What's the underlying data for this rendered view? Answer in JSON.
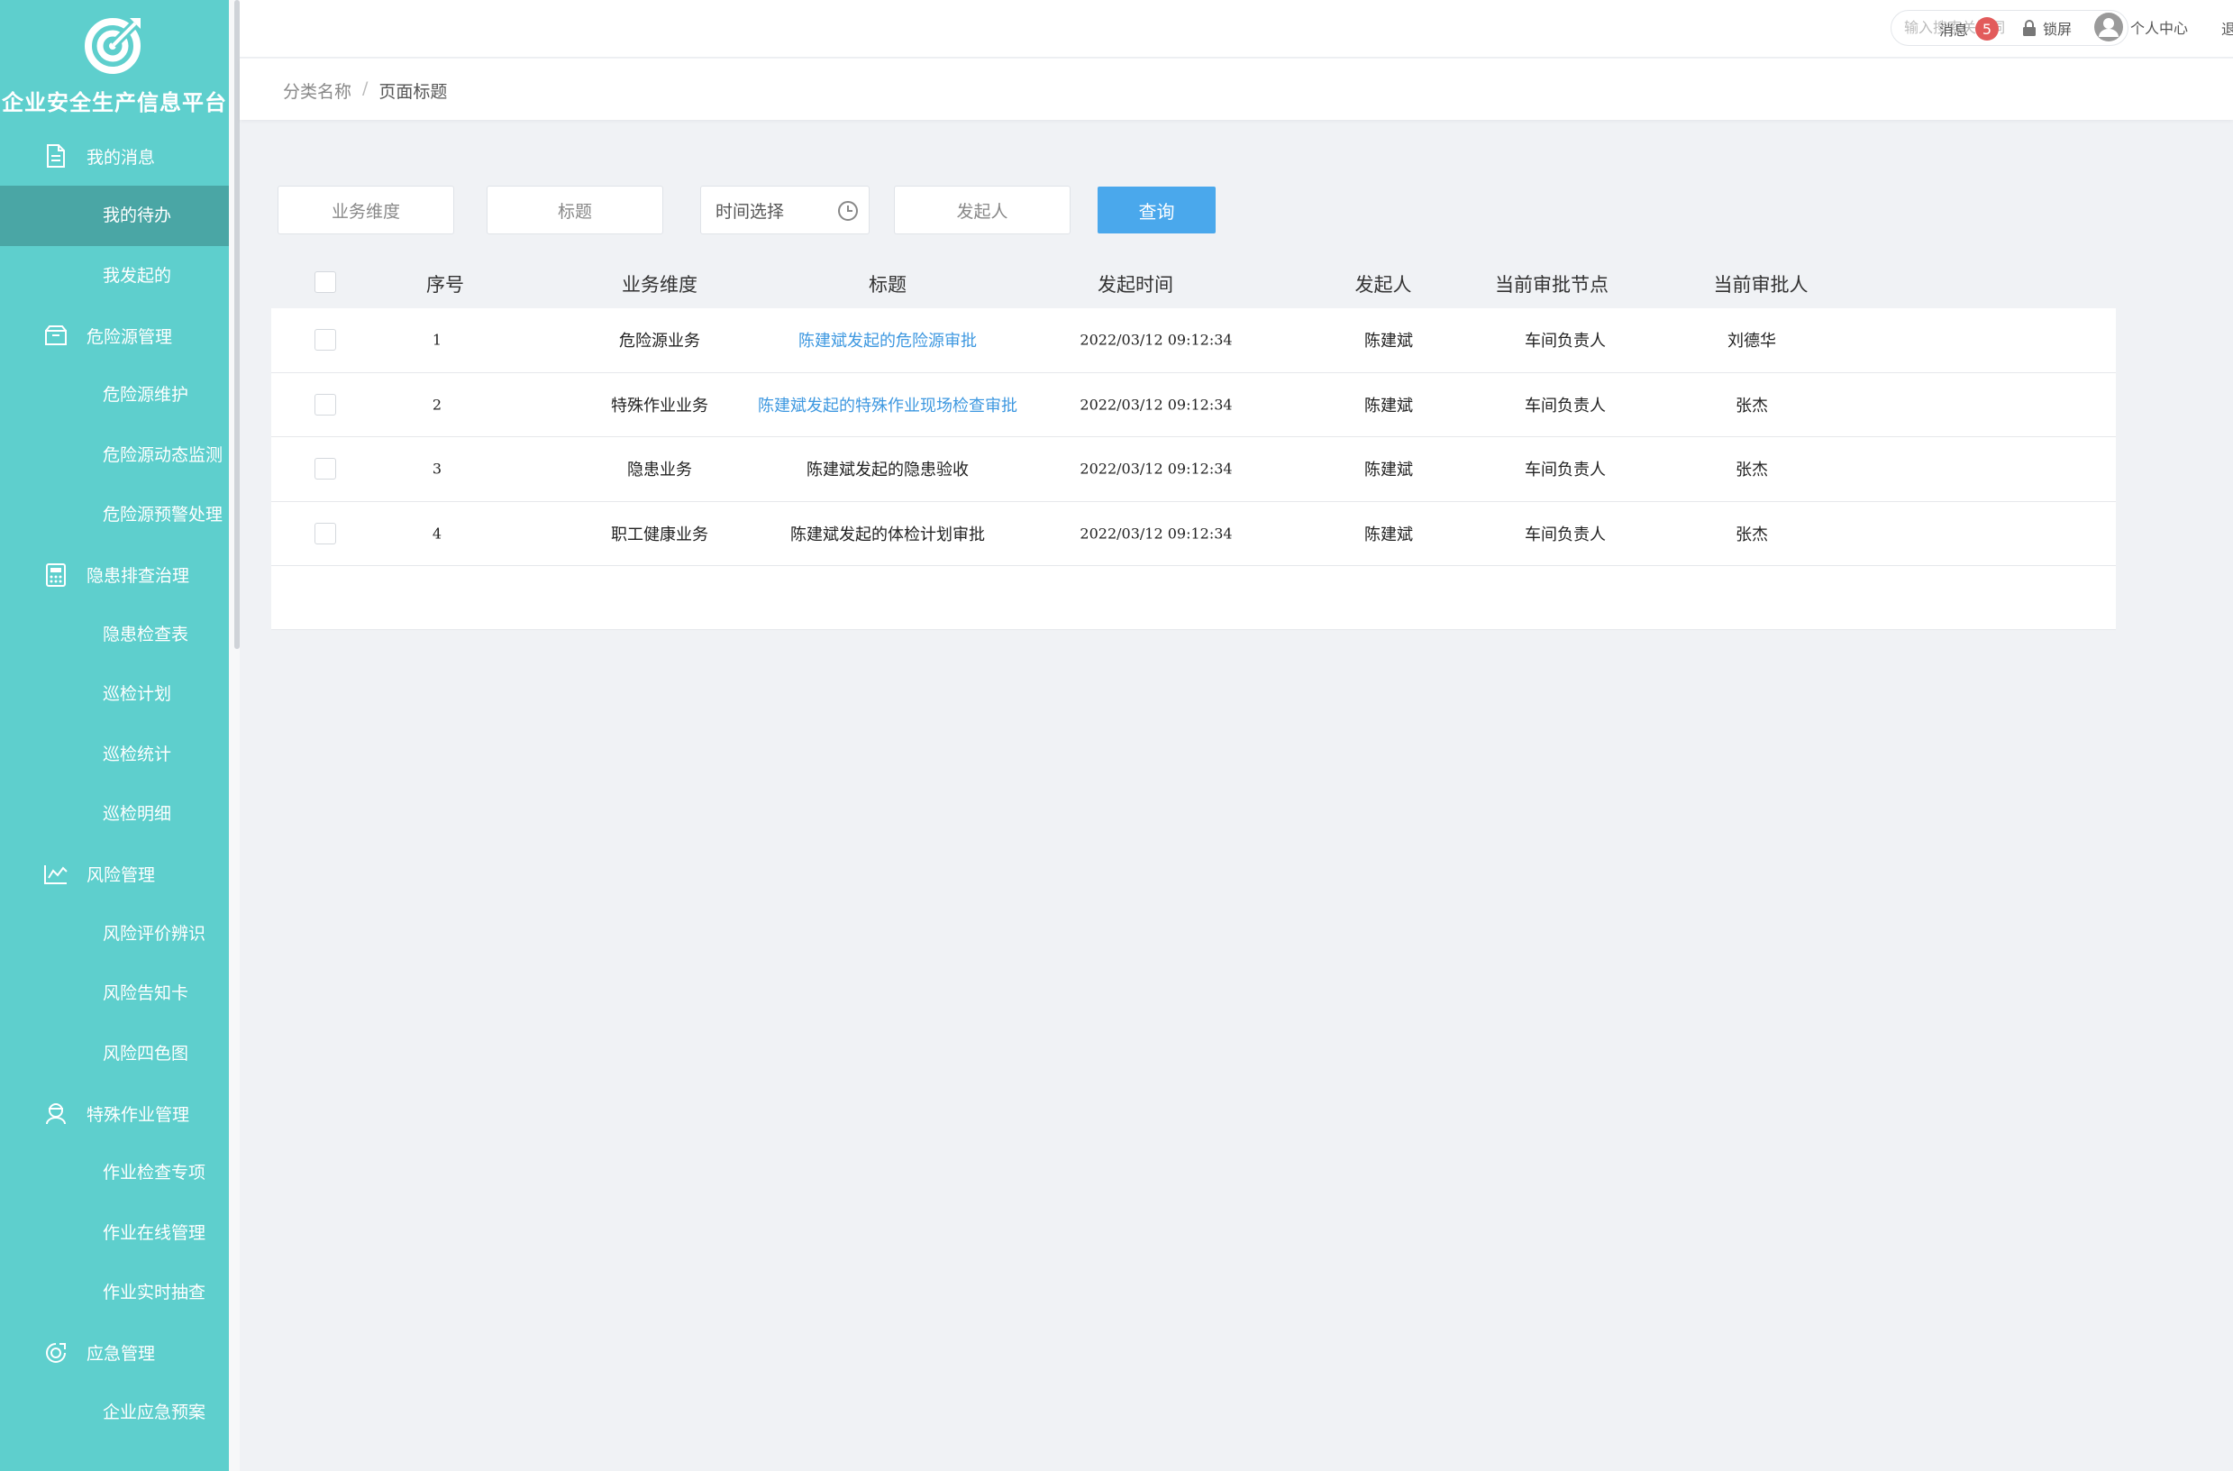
{
  "app": {
    "title": "企业安全生产信息平台"
  },
  "sidebar": {
    "groups": [
      {
        "label": "我的消息",
        "icon": "document-icon",
        "items": [
          "我的待办",
          "我发起的"
        ]
      },
      {
        "label": "危险源管理",
        "icon": "box-icon",
        "items": [
          "危险源维护",
          "危险源动态监测",
          "危险源预警处理"
        ]
      },
      {
        "label": "隐患排查治理",
        "icon": "calculator-icon",
        "items": [
          "隐患检查表",
          "巡检计划",
          "巡检统计",
          "巡检明细"
        ]
      },
      {
        "label": "风险管理",
        "icon": "chart-icon",
        "items": [
          "风险评价辨识",
          "风险告知卡",
          "风险四色图"
        ]
      },
      {
        "label": "特殊作业管理",
        "icon": "worker-icon",
        "items": [
          "作业检查专项",
          "作业在线管理",
          "作业实时抽查"
        ]
      },
      {
        "label": "应急管理",
        "icon": "emergency-icon",
        "items": [
          "企业应急预案"
        ]
      }
    ],
    "active_item": "我的待办"
  },
  "header": {
    "search_placeholder": "输入搜索关键词",
    "messages_label": "消息",
    "messages_count": "5",
    "lock_label": "锁屏",
    "user_label": "个人中心",
    "logout_label": "退"
  },
  "breadcrumb": {
    "category": "分类名称",
    "separator": "/",
    "page": "页面标题"
  },
  "filters": {
    "business": "业务维度",
    "title": "标题",
    "time": "时间选择",
    "initiator": "发起人",
    "query_button": "查询"
  },
  "table": {
    "headers": [
      "序号",
      "业务维度",
      "标题",
      "发起时间",
      "发起人",
      "当前审批节点",
      "当前审批人"
    ],
    "rows": [
      {
        "no": "1",
        "business": "危险源业务",
        "title": "陈建斌发起的危险源审批",
        "title_link": true,
        "time": "2022/03/12 09:12:34",
        "initiator": "陈建斌",
        "node": "车间负责人",
        "approver": "刘德华"
      },
      {
        "no": "2",
        "business": "特殊作业业务",
        "title": "陈建斌发起的特殊作业现场检查审批",
        "title_link": true,
        "time": "2022/03/12 09:12:34",
        "initiator": "陈建斌",
        "node": "车间负责人",
        "approver": "张杰"
      },
      {
        "no": "3",
        "business": "隐患业务",
        "title": "陈建斌发起的隐患验收",
        "title_link": false,
        "time": "2022/03/12 09:12:34",
        "initiator": "陈建斌",
        "node": "车间负责人",
        "approver": "张杰"
      },
      {
        "no": "4",
        "business": "职工健康业务",
        "title": "陈建斌发起的体检计划审批",
        "title_link": false,
        "time": "2022/03/12 09:12:34",
        "initiator": "陈建斌",
        "node": "车间负责人",
        "approver": "张杰"
      }
    ]
  },
  "colors": {
    "sidebar": "#5ecfcd",
    "sidebar_active": "#4aa6a5",
    "accent": "#4aa8ec",
    "link": "#3e98e0",
    "badge": "#e25b5b"
  }
}
